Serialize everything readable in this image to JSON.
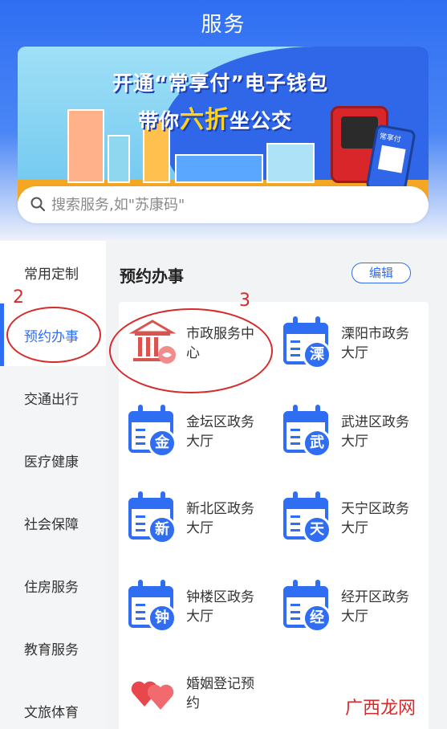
{
  "header": {
    "title": "服务"
  },
  "banner": {
    "line1": "开通“常享付”电子钱包",
    "line2_prefix": "带你",
    "line2_highlight": "六折",
    "line2_suffix": "坐公交",
    "phone_label": "常享付"
  },
  "search": {
    "placeholder": "搜索服务,如\"苏康码\""
  },
  "sidebar": {
    "items": [
      {
        "label": "常用定制"
      },
      {
        "label": "预约办事"
      },
      {
        "label": "交通出行"
      },
      {
        "label": "医疗健康"
      },
      {
        "label": "社会保障"
      },
      {
        "label": "住房服务"
      },
      {
        "label": "教育服务"
      },
      {
        "label": "文旅体育"
      }
    ],
    "active_index": 1
  },
  "main": {
    "section_title": "预约办事",
    "edit_label": "编辑",
    "tiles": [
      {
        "label": "市政服务中心",
        "badge": "",
        "icon": "government-building-icon"
      },
      {
        "label": "溧阳市政务大厅",
        "badge": "溧",
        "icon": "calendar-icon"
      },
      {
        "label": "金坛区政务大厅",
        "badge": "金",
        "icon": "calendar-icon"
      },
      {
        "label": "武进区政务大厅",
        "badge": "武",
        "icon": "calendar-icon"
      },
      {
        "label": "新北区政务大厅",
        "badge": "新",
        "icon": "calendar-icon"
      },
      {
        "label": "天宁区政务大厅",
        "badge": "天",
        "icon": "calendar-icon"
      },
      {
        "label": "钟楼区政务大厅",
        "badge": "钟",
        "icon": "calendar-icon"
      },
      {
        "label": "经开区政务大厅",
        "badge": "经",
        "icon": "calendar-icon"
      },
      {
        "label": "婚姻登记预约",
        "badge": "",
        "icon": "hearts-icon"
      }
    ]
  },
  "annotations": {
    "mark2": "2",
    "mark3": "3"
  },
  "watermark": "广西龙网",
  "colors": {
    "accent": "#2f6ef2",
    "annotation": "#d62b2b"
  }
}
